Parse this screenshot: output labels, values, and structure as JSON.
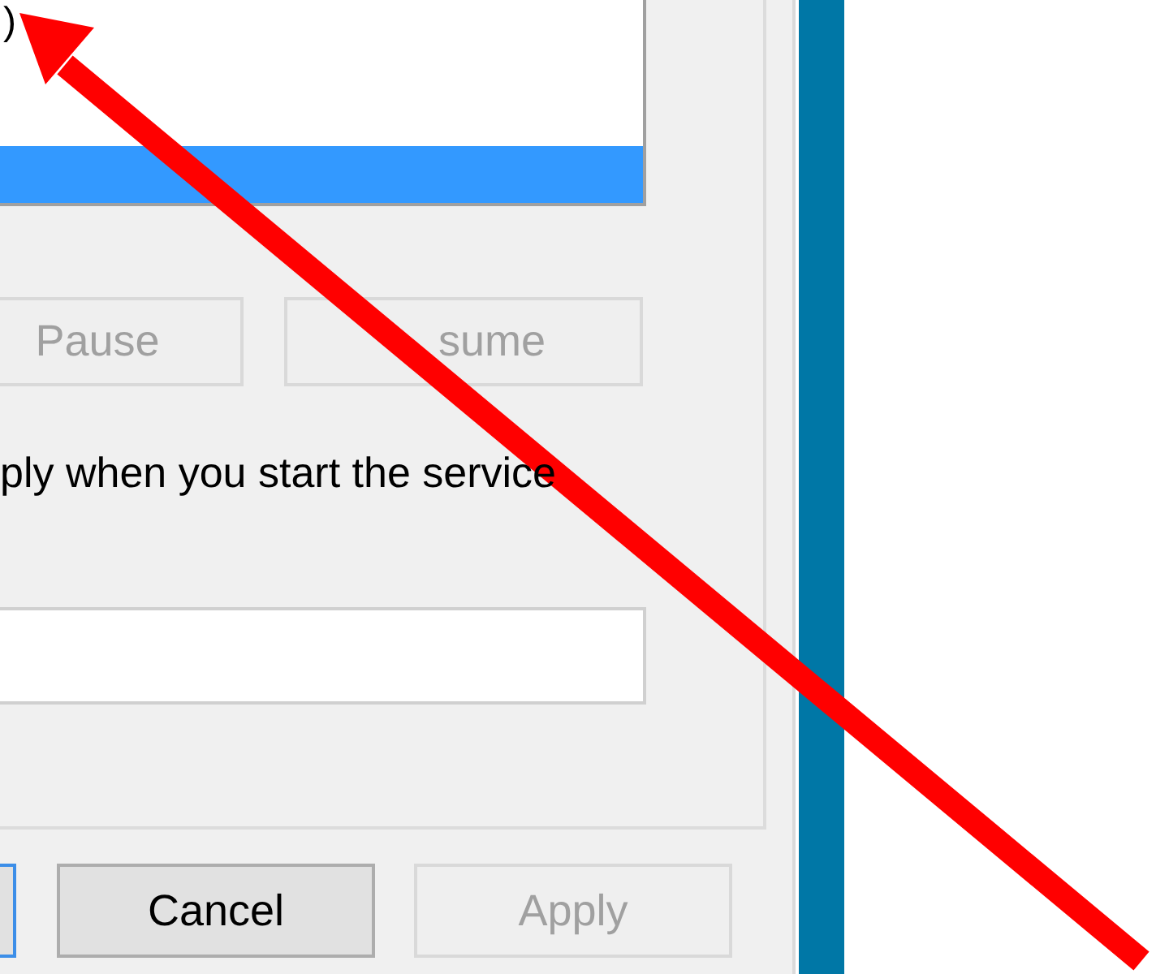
{
  "list": {
    "rows": [
      {
        "label": ")",
        "selected": false
      },
      {
        "selected": true
      }
    ]
  },
  "service_buttons": [
    {
      "label": "Pause",
      "disabled": true
    },
    {
      "label": "sume",
      "disabled": true
    }
  ],
  "parameters_hint": "ply when you start the service",
  "footer": {
    "default_button_focused": true,
    "buttons": [
      {
        "label": "Cancel",
        "disabled": false
      },
      {
        "label": "Apply",
        "disabled": true
      }
    ]
  }
}
